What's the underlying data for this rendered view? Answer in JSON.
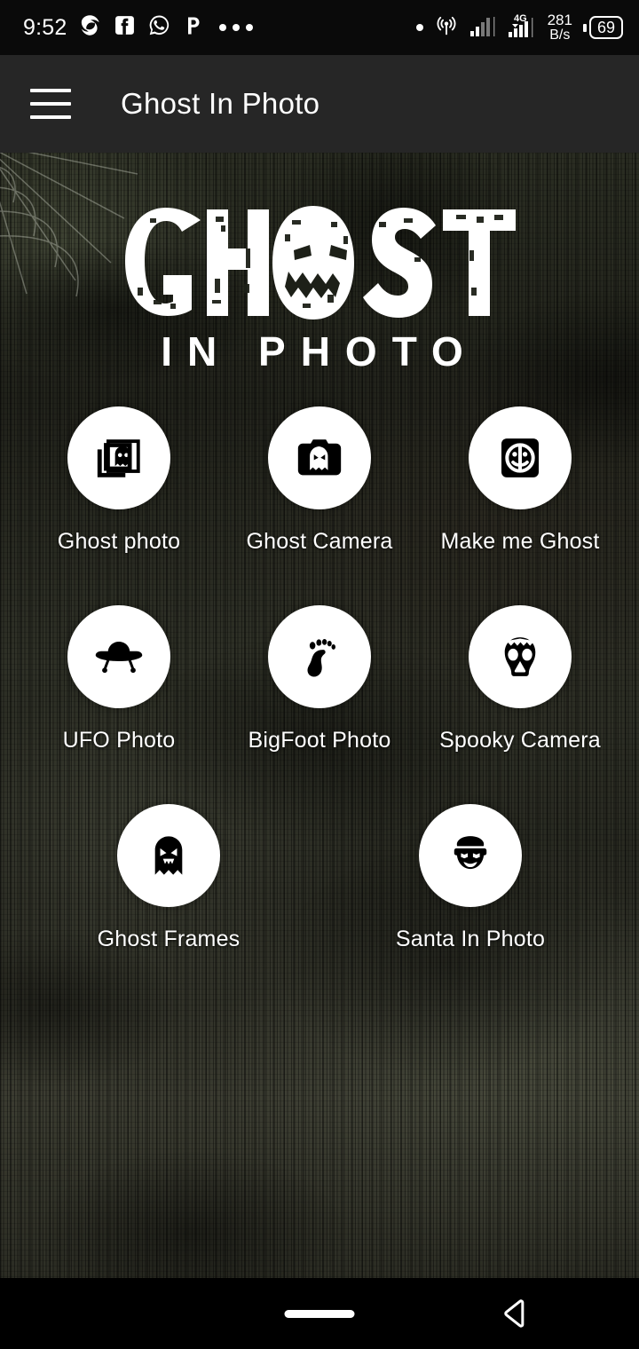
{
  "status_bar": {
    "time": "9:52",
    "notification_icons": [
      "swirl-app-icon",
      "facebook-icon",
      "whatsapp-icon",
      "p-app-icon",
      "more-notifications-icon"
    ],
    "right_icons": [
      "notification-dot",
      "hotspot-icon",
      "signal-sim1-icon",
      "signal-sim2-4g-icon"
    ],
    "network_type": "4G",
    "network_speed_value": "281",
    "network_speed_unit": "B/s",
    "battery_level": "69"
  },
  "app_bar": {
    "menu_icon": "hamburger-menu-icon",
    "title": "Ghost In Photo"
  },
  "logo": {
    "line1": "GHOST",
    "line2": "IN PHOTO"
  },
  "grid": {
    "rows": [
      [
        {
          "label": "Ghost photo",
          "icon": "ghost-photo-stack-icon"
        },
        {
          "label": "Ghost Camera",
          "icon": "ghost-camera-icon"
        },
        {
          "label": "Make me Ghost",
          "icon": "make-me-ghost-mask-icon"
        }
      ],
      [
        {
          "label": "UFO Photo",
          "icon": "ufo-icon"
        },
        {
          "label": "BigFoot Photo",
          "icon": "footprint-icon"
        },
        {
          "label": "Spooky Camera",
          "icon": "skull-mask-icon"
        }
      ],
      [
        {
          "label": "Ghost Frames",
          "icon": "ghost-silhouette-icon"
        },
        {
          "label": "Santa In Photo",
          "icon": "santa-face-icon"
        }
      ]
    ]
  },
  "nav_bar": {
    "home_pill": "home-pill-indicator",
    "back_button": "back-triangle-icon"
  },
  "colors": {
    "status_bar_bg": "#0a0a0a",
    "app_bar_bg": "#262626",
    "bubble_bg": "#ffffff",
    "icon_fg": "#000000",
    "label_fg": "#ffffff",
    "nav_bg": "#000000"
  }
}
